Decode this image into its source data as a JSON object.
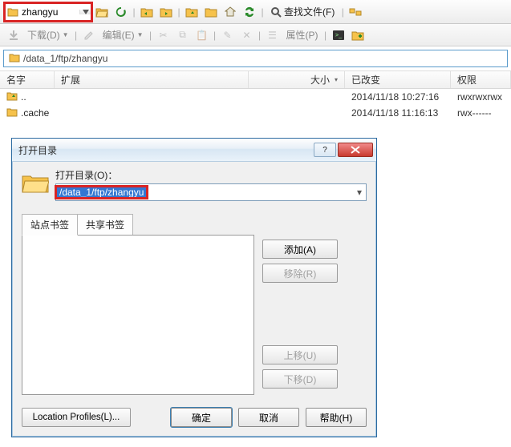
{
  "toolbar": {
    "address_combo_value": "zhangyu",
    "find_files_label": "查找文件(F)"
  },
  "toolbar2": {
    "download_label": "下载(D)",
    "edit_label": "编辑(E)",
    "properties_label": "属性(P)"
  },
  "pathbar": {
    "path": "/data_1/ftp/zhangyu"
  },
  "columns": {
    "name": "名字",
    "ext": "扩展",
    "size": "大小",
    "changed": "已改变",
    "perm": "权限"
  },
  "rows": [
    {
      "name": "..",
      "changed": "2014/11/18 10:27:16",
      "perm": "rwxrwxrwx"
    },
    {
      "name": ".cache",
      "changed": "2014/11/18 11:16:13",
      "perm": "rwx------"
    }
  ],
  "dialog": {
    "title": "打开目录",
    "open_label": "打开目录(O)：",
    "path_value": "/data_1/ftp/zhangyu",
    "tabs": {
      "site": "站点书签",
      "shared": "共享书签"
    },
    "buttons": {
      "add": "添加(A)",
      "remove": "移除(R)",
      "move_up": "上移(U)",
      "move_down": "下移(D)",
      "location_profiles": "Location Profiles(L)...",
      "ok": "确定",
      "cancel": "取消",
      "help": "帮助(H)"
    }
  }
}
